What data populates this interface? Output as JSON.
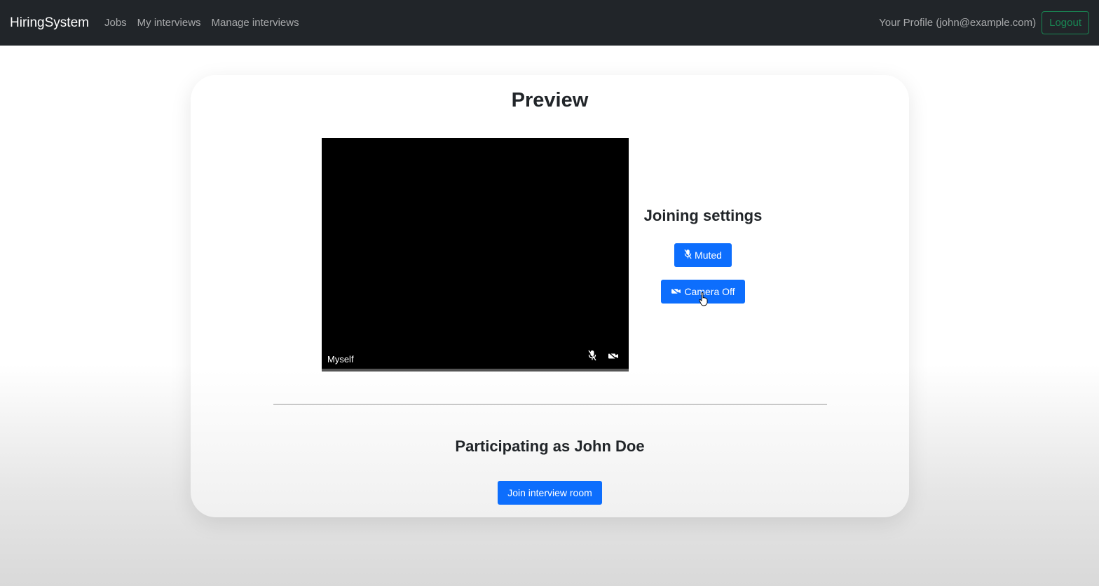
{
  "navbar": {
    "brand": "HiringSystem",
    "links": [
      "Jobs",
      "My interviews",
      "Manage interviews"
    ],
    "profile": "Your Profile (john@example.com)",
    "logout": "Logout",
    "background_color": "#212529",
    "logout_color": "#198754"
  },
  "preview": {
    "title": "Preview",
    "video_label": "Myself",
    "video_icons": [
      "mic-off-icon",
      "camera-off-icon"
    ]
  },
  "settings": {
    "title": "Joining settings",
    "mute_button": "Muted",
    "mute_icon": "mic-off-icon",
    "camera_button": "Camera Off",
    "camera_icon": "camera-off-icon",
    "accent_color": "#0d6efd"
  },
  "participation": {
    "label": "Participating as John Doe",
    "join_button": "Join interview room"
  }
}
